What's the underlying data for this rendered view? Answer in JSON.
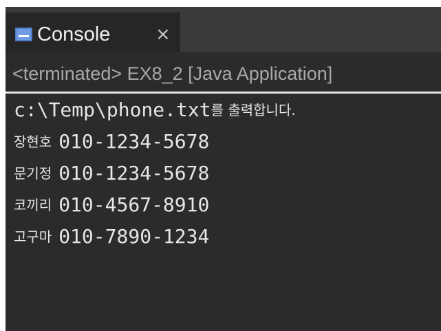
{
  "console": {
    "tab_label": "Console",
    "tab_close": "×",
    "status": "<terminated> EX8_2 [Java Application]",
    "output": {
      "header_path": "c:\\Temp\\phone.txt",
      "header_suffix_1": "를",
      "header_suffix_2": " 출력합니다.",
      "rows": [
        {
          "name": "장현호",
          "phone": "010-1234-5678"
        },
        {
          "name": "문기정",
          "phone": "010-1234-5678"
        },
        {
          "name": "코끼리",
          "phone": "010-4567-8910"
        },
        {
          "name": "고구마",
          "phone": "010-7890-1234"
        }
      ]
    }
  },
  "icons": {
    "tab_icon": "console-icon",
    "close_icon": "close-icon"
  },
  "colors": {
    "background": "#2b2b2b",
    "tab_active": "#262626",
    "tabbar": "#3a3a3a",
    "text": "#e6e6e6",
    "status_text": "#a8a8a8",
    "icon": "#6f9be0"
  }
}
